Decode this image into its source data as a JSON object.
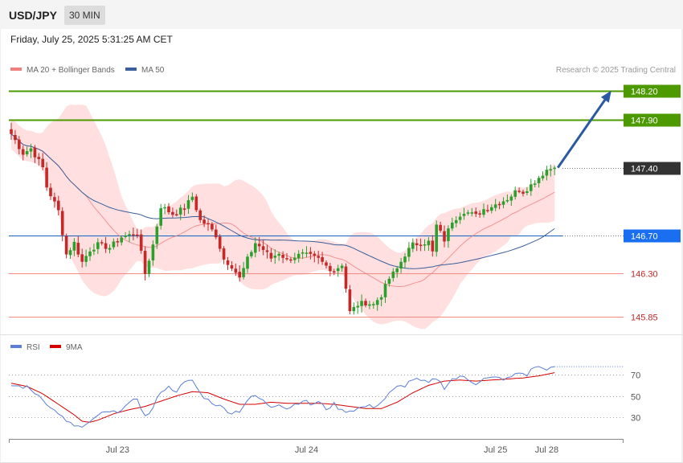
{
  "header": {
    "symbol": "USD/JPY",
    "timeframe": "30 MIN",
    "timestamp": "Friday, July 25, 2025 5:31:25 AM CET"
  },
  "colors": {
    "bull": "#2ca02c",
    "bear": "#c62828",
    "band_fill": "#ffd9d9",
    "ma20": "#f08080",
    "ma50": "#3a5f9a",
    "target": "#4c9a00",
    "support_line": "#1565c0",
    "support_badge": "#1a6ff0",
    "level_red": "#f28b82",
    "current": "#333333",
    "arrow": "#2b5aa0",
    "rsi": "#5b7fd6",
    "rsi_ma": "#d50000"
  },
  "chart_data": [
    {
      "type": "candlestick",
      "ylim": [
        145.72,
        148.34
      ],
      "legend": [
        {
          "label": "MA 20 + Bollinger Bands",
          "color": "#f08080"
        },
        {
          "label": "MA 50",
          "color": "#3a5f9a"
        }
      ],
      "watermark": "Research © 2025 Trading Central",
      "levels": [
        {
          "value": "148.20",
          "price": 148.2,
          "style": "target"
        },
        {
          "value": "147.90",
          "price": 147.9,
          "style": "target"
        },
        {
          "value": "147.40",
          "price": 147.4,
          "style": "current"
        },
        {
          "value": "146.70",
          "price": 146.7,
          "style": "support"
        },
        {
          "value": "146.30",
          "price": 146.3,
          "style": "level"
        },
        {
          "value": "145.85",
          "price": 145.85,
          "style": "level"
        }
      ],
      "x_labels": [
        {
          "label": "Jul 23",
          "index": 27
        },
        {
          "label": "Jul 24",
          "index": 75
        },
        {
          "label": "Jul 25",
          "index": 123
        },
        {
          "label": "Jul 28",
          "index": 136
        }
      ],
      "projection": {
        "from_price": 147.4,
        "to_price": 148.2,
        "from_index": 138,
        "to_index": 152
      },
      "candles_count": 139,
      "anchors": [
        [
          0,
          147.75
        ],
        [
          3,
          147.55
        ],
        [
          5,
          147.6
        ],
        [
          8,
          147.4
        ],
        [
          9,
          147.2
        ],
        [
          12,
          146.95
        ],
        [
          14,
          146.5
        ],
        [
          16,
          146.62
        ],
        [
          18,
          146.42
        ],
        [
          20,
          146.55
        ],
        [
          22,
          146.6
        ],
        [
          25,
          146.57
        ],
        [
          28,
          146.68
        ],
        [
          32,
          146.72
        ],
        [
          34,
          146.3
        ],
        [
          36,
          146.6
        ],
        [
          38,
          147.0
        ],
        [
          41,
          146.92
        ],
        [
          44,
          146.98
        ],
        [
          46,
          147.1
        ],
        [
          48,
          146.85
        ],
        [
          50,
          146.8
        ],
        [
          52,
          146.7
        ],
        [
          54,
          146.45
        ],
        [
          56,
          146.38
        ],
        [
          58,
          146.25
        ],
        [
          60,
          146.45
        ],
        [
          62,
          146.62
        ],
        [
          64,
          146.55
        ],
        [
          66,
          146.46
        ],
        [
          68,
          146.52
        ],
        [
          70,
          146.44
        ],
        [
          72,
          146.48
        ],
        [
          74,
          146.5
        ],
        [
          76,
          146.48
        ],
        [
          78,
          146.45
        ],
        [
          80,
          146.38
        ],
        [
          82,
          146.33
        ],
        [
          84,
          146.4
        ],
        [
          86,
          145.9
        ],
        [
          88,
          145.98
        ],
        [
          90,
          146.0
        ],
        [
          92,
          145.98
        ],
        [
          94,
          146.08
        ],
        [
          96,
          146.25
        ],
        [
          98,
          146.35
        ],
        [
          100,
          146.5
        ],
        [
          102,
          146.6
        ],
        [
          104,
          146.62
        ],
        [
          106,
          146.63
        ],
        [
          107,
          146.52
        ],
        [
          108,
          146.8
        ],
        [
          110,
          146.65
        ],
        [
          112,
          146.85
        ],
        [
          115,
          146.95
        ],
        [
          118,
          146.9
        ],
        [
          120,
          146.97
        ],
        [
          123,
          147.02
        ],
        [
          126,
          147.08
        ],
        [
          129,
          147.18
        ],
        [
          130,
          147.15
        ],
        [
          132,
          147.22
        ],
        [
          134,
          147.3
        ],
        [
          136,
          147.38
        ],
        [
          138,
          147.4
        ]
      ]
    },
    {
      "type": "line",
      "title": "RSI",
      "legend": [
        {
          "label": "RSI",
          "color": "#5b7fd6"
        },
        {
          "label": "9MA",
          "color": "#d50000"
        }
      ],
      "ylim": [
        10,
        90
      ],
      "yticks": [
        "70",
        "50",
        "30"
      ],
      "series": [
        {
          "name": "RSI",
          "anchors": [
            [
              0,
              60
            ],
            [
              4,
              58
            ],
            [
              8,
              48
            ],
            [
              10,
              38
            ],
            [
              12,
              34
            ],
            [
              14,
              25
            ],
            [
              16,
              22
            ],
            [
              18,
              20
            ],
            [
              20,
              24
            ],
            [
              22,
              32
            ],
            [
              24,
              34
            ],
            [
              26,
              34
            ],
            [
              28,
              38
            ],
            [
              30,
              42
            ],
            [
              32,
              48
            ],
            [
              34,
              30
            ],
            [
              36,
              38
            ],
            [
              38,
              55
            ],
            [
              40,
              58
            ],
            [
              42,
              55
            ],
            [
              44,
              62
            ],
            [
              46,
              65
            ],
            [
              48,
              52
            ],
            [
              50,
              46
            ],
            [
              52,
              42
            ],
            [
              54,
              38
            ],
            [
              56,
              34
            ],
            [
              58,
              36
            ],
            [
              60,
              46
            ],
            [
              62,
              50
            ],
            [
              64,
              45
            ],
            [
              66,
              40
            ],
            [
              68,
              43
            ],
            [
              70,
              38
            ],
            [
              72,
              42
            ],
            [
              74,
              46
            ],
            [
              76,
              42
            ],
            [
              78,
              44
            ],
            [
              80,
              38
            ],
            [
              82,
              42
            ],
            [
              84,
              36
            ],
            [
              86,
              36
            ],
            [
              88,
              38
            ],
            [
              90,
              40
            ],
            [
              92,
              40
            ],
            [
              94,
              44
            ],
            [
              96,
              52
            ],
            [
              98,
              58
            ],
            [
              100,
              60
            ],
            [
              102,
              66
            ],
            [
              104,
              64
            ],
            [
              106,
              62
            ],
            [
              108,
              67
            ],
            [
              110,
              58
            ],
            [
              112,
              66
            ],
            [
              115,
              68
            ],
            [
              118,
              62
            ],
            [
              120,
              66
            ],
            [
              123,
              67
            ],
            [
              126,
              66
            ],
            [
              129,
              72
            ],
            [
              131,
              70
            ],
            [
              133,
              78
            ],
            [
              135,
              76
            ],
            [
              138,
              76
            ]
          ]
        },
        {
          "name": "9MA",
          "anchors": [
            [
              0,
              62
            ],
            [
              4,
              59
            ],
            [
              8,
              52
            ],
            [
              12,
              42
            ],
            [
              16,
              32
            ],
            [
              18,
              26
            ],
            [
              20,
              25
            ],
            [
              22,
              27
            ],
            [
              26,
              33
            ],
            [
              30,
              37
            ],
            [
              34,
              40
            ],
            [
              38,
              45
            ],
            [
              42,
              50
            ],
            [
              46,
              54
            ],
            [
              50,
              53
            ],
            [
              54,
              47
            ],
            [
              58,
              42
            ],
            [
              62,
              42
            ],
            [
              66,
              44
            ],
            [
              70,
              43
            ],
            [
              74,
              43
            ],
            [
              78,
              43
            ],
            [
              82,
              42
            ],
            [
              86,
              40
            ],
            [
              90,
              38
            ],
            [
              94,
              38
            ],
            [
              98,
              44
            ],
            [
              102,
              53
            ],
            [
              106,
              60
            ],
            [
              110,
              64
            ],
            [
              114,
              65
            ],
            [
              118,
              64
            ],
            [
              122,
              65
            ],
            [
              126,
              66
            ],
            [
              130,
              67
            ],
            [
              134,
              69
            ],
            [
              138,
              72
            ]
          ]
        }
      ]
    }
  ]
}
